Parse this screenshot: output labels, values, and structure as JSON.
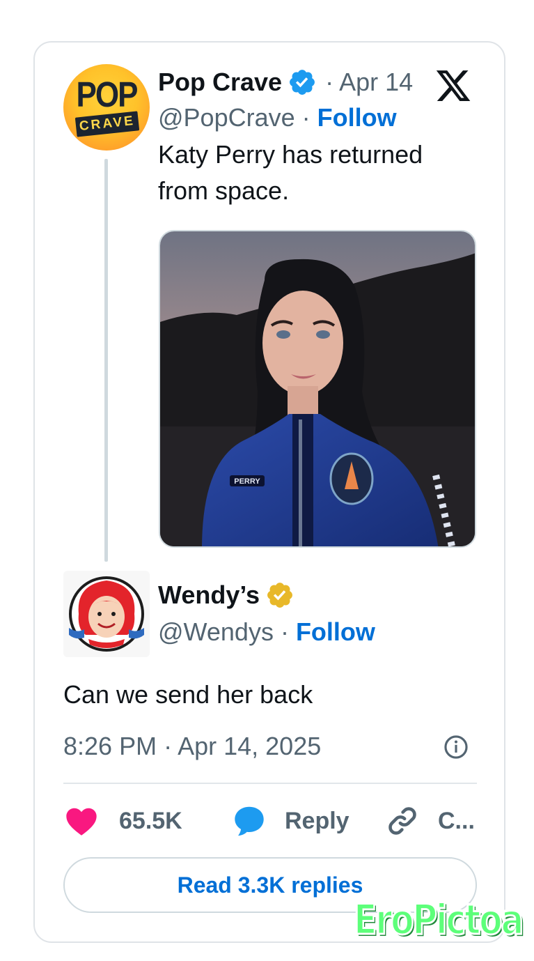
{
  "tweet": {
    "author_name": "Pop Crave",
    "date": "· Apr 14",
    "handle": "@PopCrave",
    "separator": " · ",
    "follow_label": "Follow",
    "text": "Katy Perry has returned from space.",
    "avatar": {
      "word_top": "POP",
      "word_bottom": "CRAVE"
    },
    "media": {
      "name_patch": "PERRY",
      "description_icon": "photo"
    }
  },
  "reply": {
    "author_name": "Wendy’s",
    "handle": "@Wendys",
    "separator": " · ",
    "follow_label": "Follow",
    "text": "Can we send her back",
    "timestamp": "8:26 PM · Apr 14, 2025"
  },
  "actions": {
    "like_count": "65.5K",
    "reply_label": "Reply",
    "copy_label": "C..."
  },
  "read_replies_label": "Read 3.3K replies",
  "watermark": "EroPictoa",
  "colors": {
    "link_blue": "#006fd6",
    "verified_blue": "#1d9bf0",
    "verified_gold": "#e8b829",
    "like_pink": "#f91880",
    "reply_blue": "#1d9bf0"
  },
  "icons": [
    "x-logo-icon",
    "verified-badge-icon",
    "gold-verified-badge-icon",
    "info-icon",
    "heart-icon",
    "reply-bubble-icon",
    "link-icon"
  ]
}
